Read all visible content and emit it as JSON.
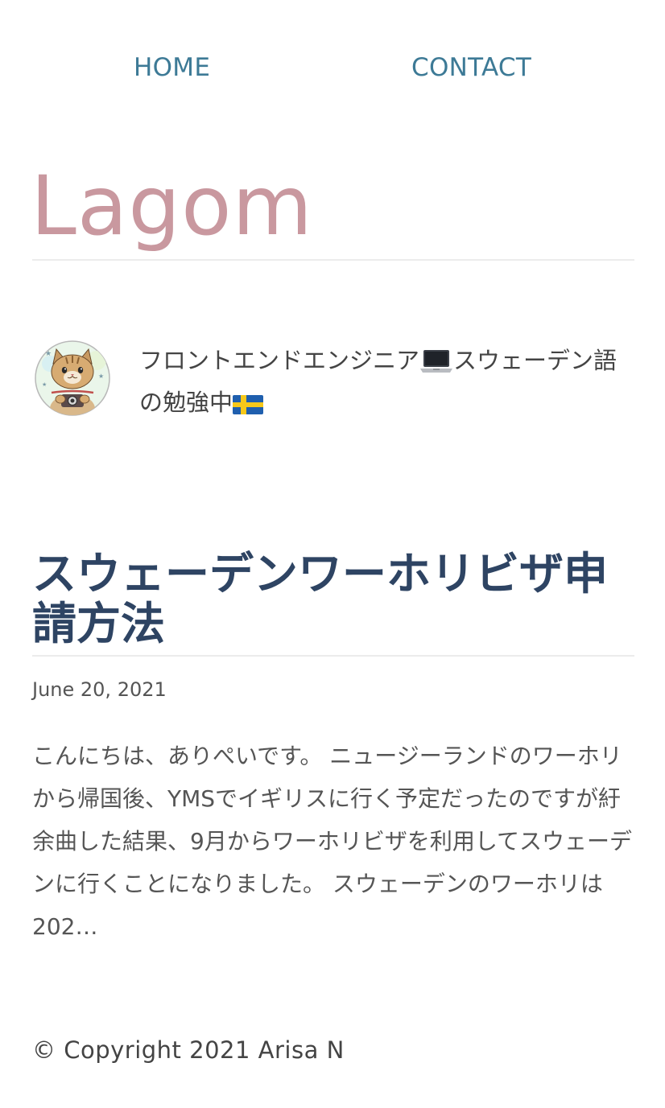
{
  "nav": {
    "home_label": "HOME",
    "contact_label": "CONTACT"
  },
  "site": {
    "title": "Lagom"
  },
  "profile": {
    "bio_part1": "フロントエンドエンジニア",
    "bio_part2": "スウェーデン語の勉強中",
    "icons": [
      "laptop-icon",
      "swedish-flag-icon",
      "cat-avatar"
    ]
  },
  "post": {
    "title": "スウェーデンワーホリビザ申請方法",
    "date": "June 20, 2021",
    "excerpt": "こんにちは、ありぺいです。 ニュージーランドのワーホリから帰国後、YMSでイギリスに行く予定だったのですが紆余曲した結果、9月からワーホリビザを利用してスウェーデンに行くことになりました。 スウェーデンのワーホリは202…"
  },
  "footer": {
    "copyright": "© Copyright 2021 Arisa N"
  },
  "colors": {
    "nav_link": "#3d7a96",
    "site_title": "#c9989f",
    "post_title": "#2e4463",
    "body_text": "#555555"
  }
}
